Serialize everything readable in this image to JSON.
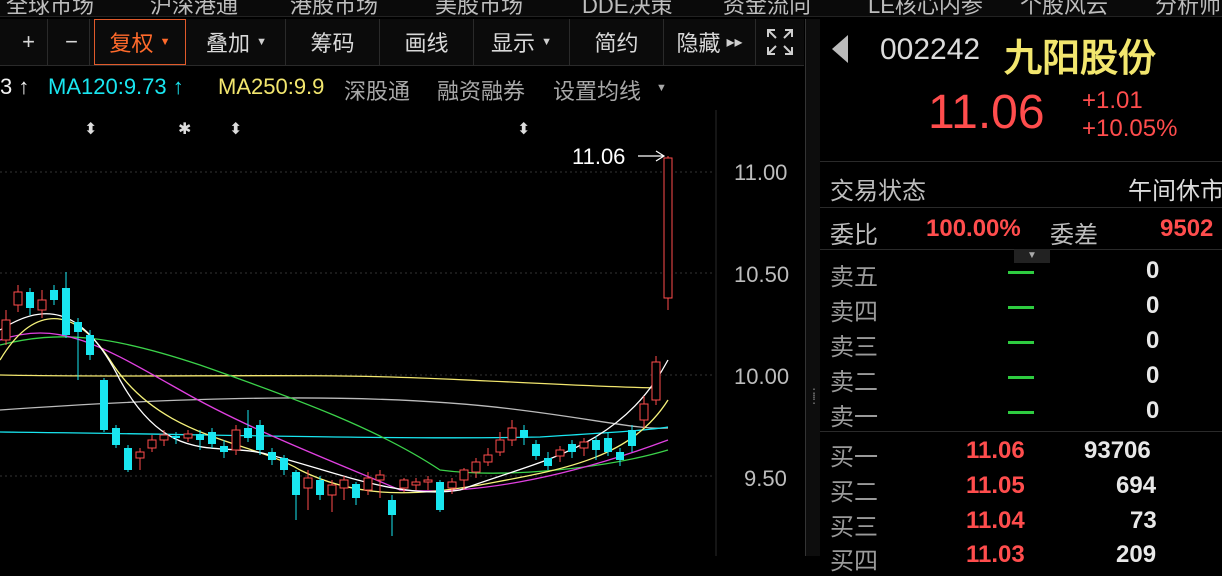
{
  "top_tabs": [
    "全球市场",
    "沪深港通",
    "港股市场",
    "美股市场",
    "DDE决策",
    "资金流向",
    "LE核心内参",
    "个股风云",
    "分析师"
  ],
  "toolbar": {
    "plus_label": "+",
    "minus_label": "−",
    "fuquan_label": "复权",
    "diejia_label": "叠加",
    "chouma_label": "筹码",
    "huaxian_label": "画线",
    "xianshi_label": "显示",
    "jianyue_label": "简约",
    "yincang_label": "隐藏",
    "fullscreen_icon": "expand-icon"
  },
  "ma_legend": {
    "ma_prev_tail": "3 ↑",
    "ma120_label": "MA120:9.73 ↑",
    "ma250_label": "MA250:9.9",
    "shengutong": "深股通",
    "rongzi": "融资融券",
    "settings": "设置均线",
    "ma120_color": "#19e6f0",
    "ma250_color": "#f2e66e"
  },
  "chart_data": {
    "type": "candlestick",
    "last_price_label": "11.06",
    "y_ticks": [
      "11.00",
      "10.50",
      "10.00",
      "9.50"
    ],
    "ylim": [
      9.5,
      11.0
    ],
    "up_color": "#ff4d4d",
    "down_color": "#19e6f0"
  },
  "quote": {
    "code": "002242",
    "name": "九阳股份",
    "price": "11.06",
    "change": "+1.01",
    "change_pct": "+10.05%",
    "status_label": "交易状态",
    "status_value": "午间休市",
    "weibi_label": "委比",
    "weibi_value": "100.00%",
    "weicha_label": "委差",
    "weicha_value": "9502",
    "sell": [
      {
        "label": "卖五",
        "volume": "0"
      },
      {
        "label": "卖四",
        "volume": "0"
      },
      {
        "label": "卖三",
        "volume": "0"
      },
      {
        "label": "卖二",
        "volume": "0"
      },
      {
        "label": "卖一",
        "volume": "0"
      }
    ],
    "buy": [
      {
        "label": "买一",
        "price": "11.06",
        "volume": "93706"
      },
      {
        "label": "买二",
        "price": "11.05",
        "volume": "694"
      },
      {
        "label": "买三",
        "price": "11.04",
        "volume": "73"
      },
      {
        "label": "买四",
        "price": "11.03",
        "volume": "209"
      }
    ]
  }
}
